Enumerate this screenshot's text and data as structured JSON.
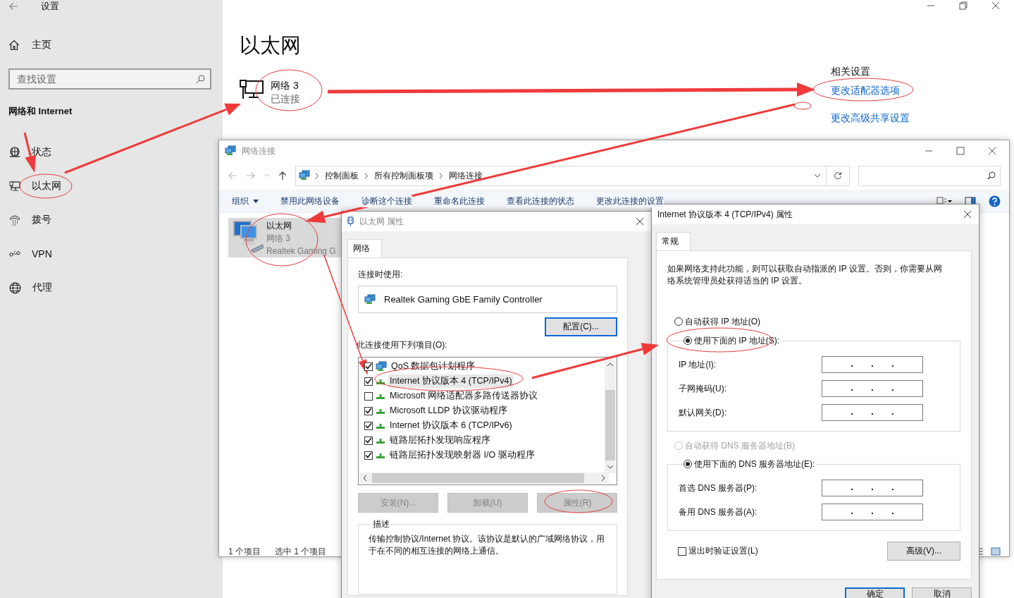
{
  "settings": {
    "title": "设置",
    "home": "主页",
    "search": {
      "placeholder": "查找设置"
    },
    "section": "网络和 Internet",
    "nav": [
      {
        "kind": "status",
        "label": "状态"
      },
      {
        "kind": "ethernet",
        "label": "以太网"
      },
      {
        "kind": "dialup",
        "label": "拨号"
      },
      {
        "kind": "vpn",
        "label": "VPN"
      },
      {
        "kind": "proxy",
        "label": "代理"
      }
    ],
    "page_title": "以太网",
    "connection": {
      "name": "网络 3",
      "status": "已连接"
    },
    "related": {
      "heading": "相关设置",
      "links": [
        "更改适配器选项",
        "更改高级共享设置"
      ]
    }
  },
  "explorer": {
    "title": "网络连接",
    "breadcrumb": [
      "控制面板",
      "所有控制面板项",
      "网络连接"
    ],
    "toolbar": [
      {
        "label": "组织",
        "kind": "menu"
      },
      {
        "label": "禁用此网络设备",
        "kind": "command"
      },
      {
        "label": "诊断这个连接",
        "kind": "command"
      },
      {
        "label": "重命名此连接",
        "kind": "command"
      },
      {
        "label": "查看此连接的状态",
        "kind": "command"
      },
      {
        "label": "更改此连接的设置",
        "kind": "command"
      }
    ],
    "items": [
      {
        "name": "以太网",
        "network": "网络 3",
        "adapter": "Realtek Gaming G",
        "selected": true
      }
    ],
    "status": [
      "1 个项目",
      "选中 1 个项目"
    ]
  },
  "eth": {
    "title": "以太网 属性",
    "tab": "网络",
    "connect_label": "连接时使用:",
    "adapter": "Realtek Gaming GbE Family Controller",
    "configure": "配置(C)...",
    "items_label": "此连接使用下列项目(O):",
    "components": [
      {
        "kind": "service",
        "label": "QoS 数据包计划程序",
        "checked": true,
        "selected": false
      },
      {
        "kind": "protocol",
        "label": "Internet 协议版本 4 (TCP/IPv4)",
        "checked": true,
        "selected": true
      },
      {
        "kind": "protocol",
        "label": "Microsoft 网络适配器多路传送器协议",
        "checked": false,
        "selected": false
      },
      {
        "kind": "protocol",
        "label": "Microsoft LLDP 协议驱动程序",
        "checked": true,
        "selected": false
      },
      {
        "kind": "protocol",
        "label": "Internet 协议版本 6 (TCP/IPv6)",
        "checked": true,
        "selected": false
      },
      {
        "kind": "protocol",
        "label": "链路层拓扑发现响应程序",
        "checked": true,
        "selected": false
      },
      {
        "kind": "protocol",
        "label": "链路层拓扑发现映射器 I/O 驱动程序",
        "checked": true,
        "selected": false
      }
    ],
    "buttons": [
      {
        "label": "安装(N)...",
        "disabled": true
      },
      {
        "label": "卸载(U)",
        "disabled": true
      },
      {
        "label": "属性(R)",
        "disabled": true
      }
    ],
    "description_label": "描述",
    "description": "传输控制协议/Internet 协议。该协议是默认的广域网络协议，用于在不同的相互连接的网络上通信。"
  },
  "ipv4": {
    "title": "Internet 协议版本 4 (TCP/IPv4) 属性",
    "tab": "常规",
    "intro": "如果网络支持此功能，则可以获取自动指派的 IP 设置。否则，你需要从网络系统管理员处获得适当的 IP 设置。",
    "ip_auto": {
      "label": "自动获得 IP 地址(O)",
      "selected": false,
      "disabled": false
    },
    "ip_manual": {
      "label": "使用下面的 IP 地址(S):",
      "selected": true,
      "disabled": false
    },
    "ip_fields": [
      "IP 地址(I):",
      "子网掩码(U):",
      "默认网关(D):"
    ],
    "dns_auto": {
      "label": "自动获得 DNS 服务器地址(B)",
      "selected": false,
      "disabled": true
    },
    "dns_manual": {
      "label": "使用下面的 DNS 服务器地址(E):",
      "selected": true,
      "disabled": false
    },
    "dns_fields": [
      "首选 DNS 服务器(P):",
      "备用 DNS 服务器(A):"
    ],
    "validate": {
      "label": "退出时验证设置(L)",
      "checked": false
    },
    "advanced": "高级(V)...",
    "buttons": [
      "确定",
      "取消"
    ]
  }
}
